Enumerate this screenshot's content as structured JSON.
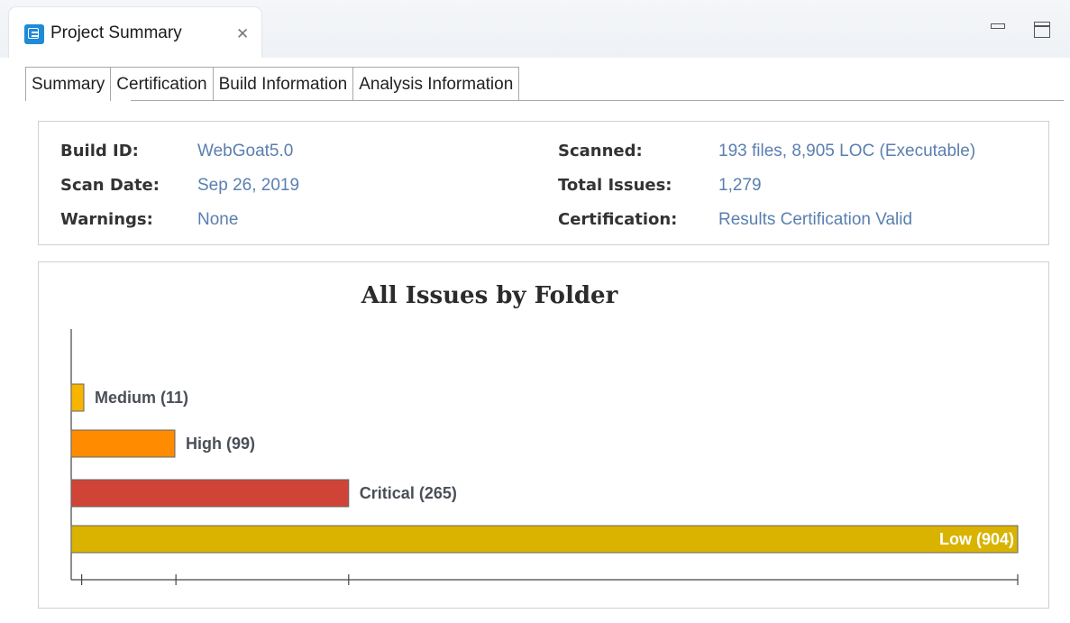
{
  "view": {
    "title": "Project Summary",
    "icon": "project-summary-icon",
    "close_glyph": "✕"
  },
  "tabs": [
    {
      "label": "Summary",
      "active": true
    },
    {
      "label": "Certification",
      "active": false
    },
    {
      "label": "Build Information",
      "active": false
    },
    {
      "label": "Analysis Information",
      "active": false
    }
  ],
  "info": {
    "build_id_label": "Build ID:",
    "build_id_value": "WebGoat5.0",
    "scan_date_label": "Scan Date:",
    "scan_date_value": "Sep 26, 2019",
    "warnings_label": "Warnings:",
    "warnings_value": "None",
    "scanned_label": "Scanned:",
    "scanned_value": "193 files, 8,905 LOC (Executable)",
    "total_issues_label": "Total Issues:",
    "total_issues_value": "1,279",
    "certification_label": "Certification:",
    "certification_value": "Results Certification Valid"
  },
  "chart_data": {
    "type": "bar",
    "orientation": "horizontal",
    "title": "All Issues by Folder",
    "categories": [
      "Medium",
      "High",
      "Critical",
      "Low"
    ],
    "values": [
      11,
      99,
      265,
      904
    ],
    "labels": [
      "Medium (11)",
      "High (99)",
      "Critical (265)",
      "Low (904)"
    ],
    "colors": [
      "#f7b500",
      "#ff8c00",
      "#d04437",
      "#d9b300"
    ],
    "xlim": [
      0,
      904
    ],
    "tick_values": [
      10,
      100,
      265,
      904
    ],
    "grid": false,
    "legend": "none"
  }
}
